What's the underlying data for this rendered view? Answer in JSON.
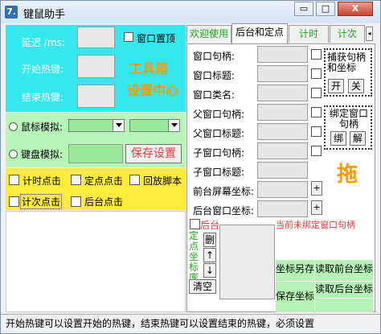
{
  "window": {
    "title": "键鼠助手",
    "logo": "7.",
    "buttons": {
      "restore": "▭",
      "maximize": "□",
      "close": "X"
    }
  },
  "hotkeys": {
    "delay_label": "延迟 /ms:",
    "start_label": "开始热键:",
    "stop_label": "结束热键:",
    "topmost_label": "窗口置顶",
    "toolbox_label": "工具箱",
    "settings_center_label": "设置中心"
  },
  "mode": {
    "mouse_label": "鼠标模拟:",
    "keyboard_label": "键盘模拟:",
    "save_settings": "保存设置"
  },
  "actions": {
    "timed_click": "计时点击",
    "fixed_click": "定点点击",
    "replay_script": "回放脚本",
    "count_click": "计次点击",
    "background_click": "后台点击"
  },
  "tabs": [
    "欢迎使用",
    "后台和定点",
    "计时",
    "计次"
  ],
  "fields": [
    "窗口句柄:",
    "窗口标题:",
    "窗口类名:",
    "父窗口句柄:",
    "父窗口标题:",
    "子窗口句柄:",
    "子窗口标题:",
    "前台屏幕坐标:",
    "后台窗口坐标:"
  ],
  "capture_box": {
    "title": "捕获句柄和坐标",
    "on": "开",
    "off": "关"
  },
  "bind_box": {
    "title": "绑定窗口句柄",
    "bind": "绑",
    "unbind": "解"
  },
  "drag_label": "拖",
  "plus": "+",
  "background_label": "后台",
  "unbound_warning": "当前未绑定窗口句柄",
  "coord_library": {
    "label": "定点坐标库",
    "delete": "删",
    "up": "↑",
    "down": "↓",
    "clear": "清空"
  },
  "coord_buttons": {
    "save_as": "坐标另存",
    "read_front": "读取前台坐标",
    "read_back": "读取后台坐标",
    "save_coords": "保存坐标"
  },
  "status_text": "开始热键可以设置开始的热键，结束热键可以设置结束的热键，必须设置"
}
